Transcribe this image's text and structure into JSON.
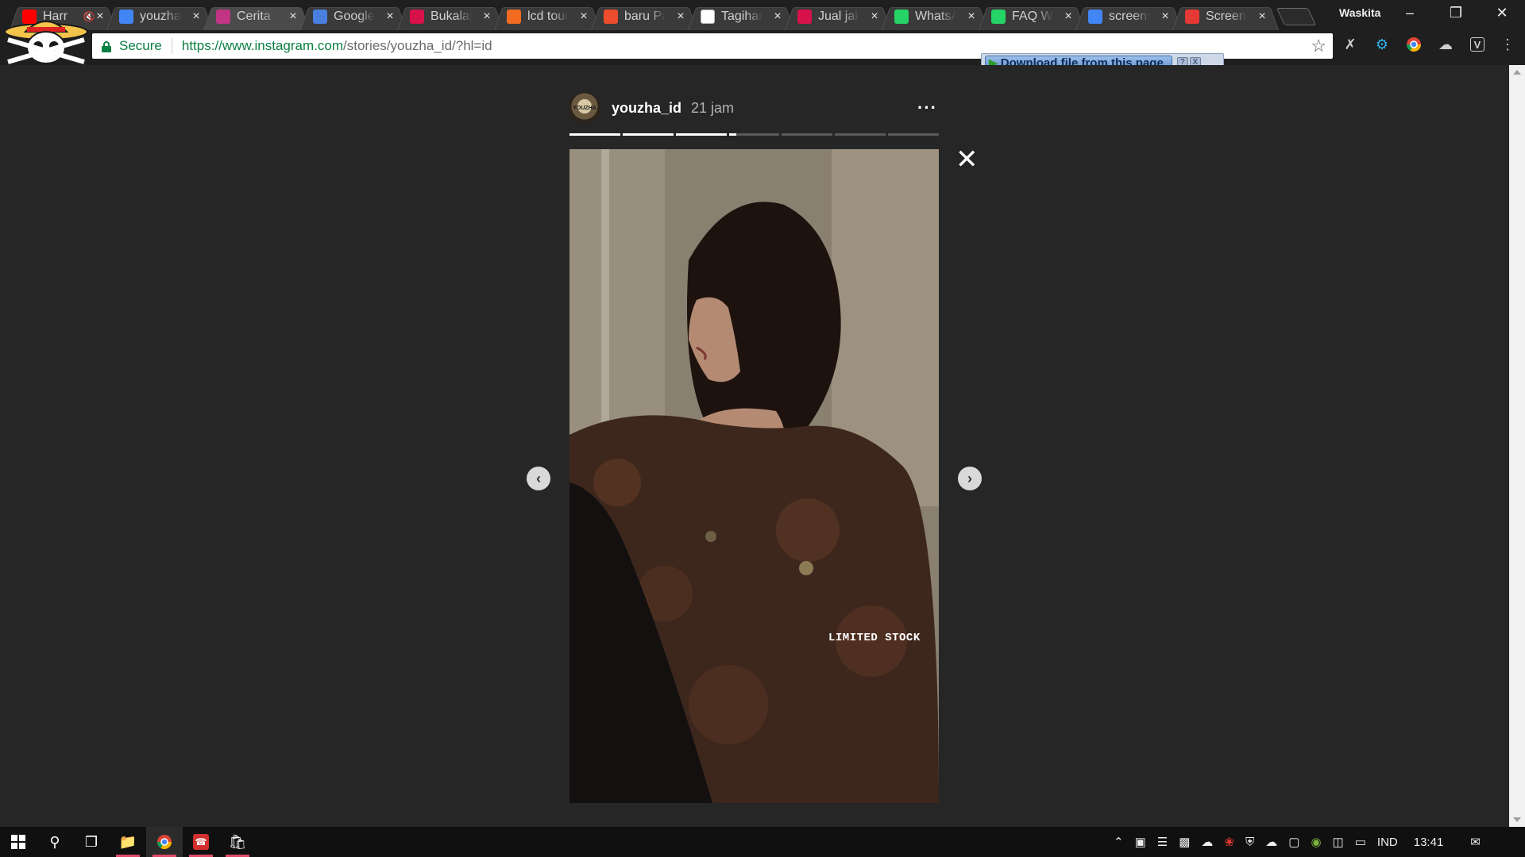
{
  "browser": {
    "profile_name": "Waskita",
    "tabs": [
      {
        "label": "Harr",
        "icon": "youtube-icon",
        "color": "#ff0000",
        "muted": true,
        "active": false
      },
      {
        "label": "youzha",
        "icon": "google-icon",
        "color": "#4285f4",
        "active": false
      },
      {
        "label": "Cerita",
        "icon": "instagram-icon",
        "color": "#c13584",
        "active": true
      },
      {
        "label": "Google",
        "icon": "google-translate-icon",
        "color": "#4a7fe0",
        "active": false
      },
      {
        "label": "Bukalap",
        "icon": "bukalapak-icon",
        "color": "#d71149",
        "active": false
      },
      {
        "label": "lcd touc",
        "icon": "shop-icon",
        "color": "#f26b21",
        "active": false
      },
      {
        "label": "baru Pa",
        "icon": "shopee-icon",
        "color": "#ee4d2d",
        "active": false
      },
      {
        "label": "Tagihan",
        "icon": "gmail-icon",
        "color": "#ffffff",
        "active": false
      },
      {
        "label": "Jual jak",
        "icon": "bukalapak-icon",
        "color": "#d71149",
        "active": false
      },
      {
        "label": "WhatsA",
        "icon": "whatsapp-icon",
        "color": "#25d366",
        "active": false
      },
      {
        "label": "FAQ W",
        "icon": "whatsapp-icon",
        "color": "#25d366",
        "active": false
      },
      {
        "label": "screens",
        "icon": "google-icon",
        "color": "#4285f4",
        "active": false
      },
      {
        "label": "Screen",
        "icon": "screencast-icon",
        "color": "#e53935",
        "active": false
      }
    ],
    "address": {
      "secure_label": "Secure",
      "url_host": "https://www.instagram.com",
      "url_path": "/stories/youzha_id/?hl=id"
    },
    "download_banner": {
      "label": "Download file from this page",
      "help": "?",
      "close": "X"
    }
  },
  "story": {
    "username": "youzha_id",
    "time": "21 jam",
    "more": "···",
    "avatar_text": "YOUZHA",
    "caption": "LIMITED STOCK",
    "progress": [
      1,
      1,
      1,
      0.15,
      0,
      0,
      0
    ]
  },
  "taskbar": {
    "language": "IND",
    "clock": "13:41"
  },
  "colors": {
    "accent_green": "#0b8043",
    "page_bg": "#262626"
  }
}
